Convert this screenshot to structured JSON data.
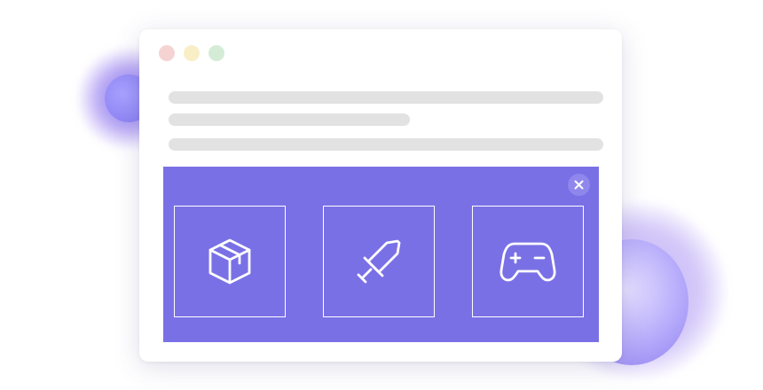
{
  "window": {
    "controls": [
      "close",
      "minimize",
      "maximize"
    ],
    "placeholder_lines": 3
  },
  "panel": {
    "background_color": "#7a70e6",
    "close_icon": "close-icon",
    "tiles": [
      {
        "icon": "package-box-icon"
      },
      {
        "icon": "sword-icon"
      },
      {
        "icon": "gamepad-icon"
      }
    ]
  },
  "colors": {
    "accent": "#7a70e6",
    "blob": "#8478ef",
    "placeholder": "#e2e2e2"
  }
}
